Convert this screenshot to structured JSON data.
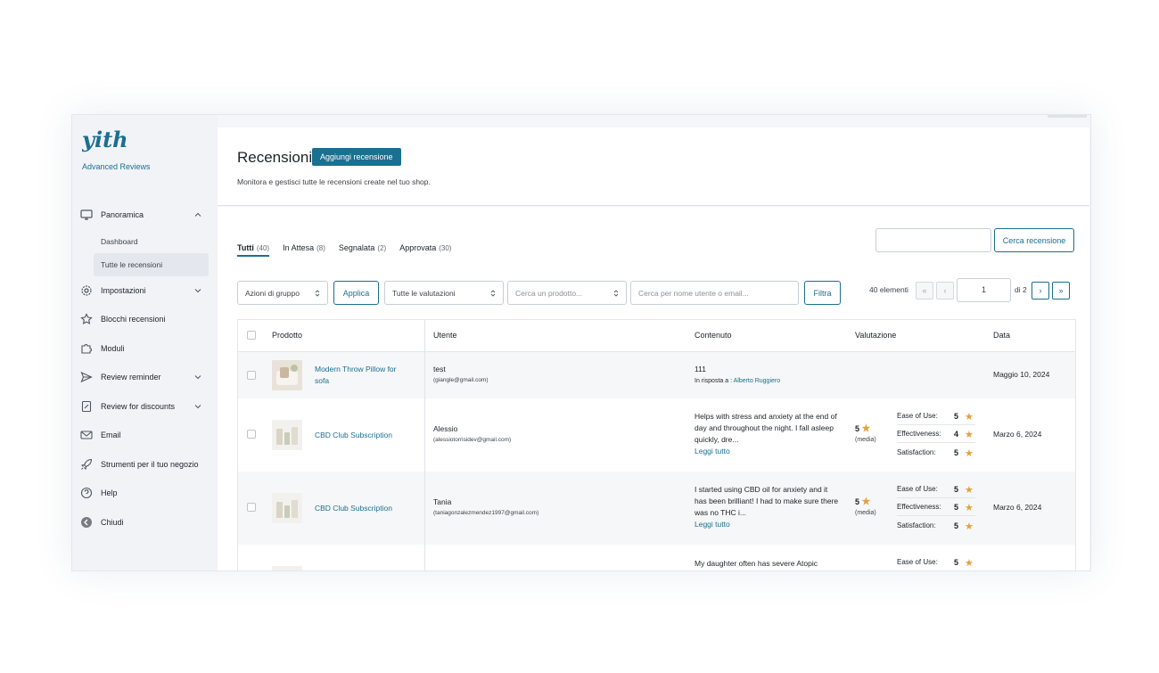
{
  "brand": {
    "logo_text": "yith",
    "product_name": "Advanced Reviews"
  },
  "sidebar": {
    "items": [
      {
        "label": "Panoramica",
        "icon": "monitor-icon",
        "expanded": true,
        "subitems": [
          {
            "label": "Dashboard"
          },
          {
            "label": "Tutte le recensioni",
            "active": true
          }
        ]
      },
      {
        "label": "Impostazioni",
        "icon": "gear-icon",
        "chevron": true
      },
      {
        "label": "Blocchi recensioni",
        "icon": "star-outline-icon"
      },
      {
        "label": "Moduli",
        "icon": "puzzle-icon"
      },
      {
        "label": "Review reminder",
        "icon": "send-icon",
        "chevron": true
      },
      {
        "label": "Review for discounts",
        "icon": "coupon-icon",
        "chevron": true
      },
      {
        "label": "Email",
        "icon": "mail-icon"
      },
      {
        "label": "Strumenti per il tuo negozio",
        "icon": "rocket-icon"
      },
      {
        "label": "Help",
        "icon": "help-icon"
      },
      {
        "label": "Chiudi",
        "icon": "collapse-icon"
      }
    ]
  },
  "header": {
    "title": "Recensioni",
    "add_button": "Aggiungi recensione",
    "subtitle": "Monitora e gestisci tutte le recensioni create nel tuo shop."
  },
  "search": {
    "value": "",
    "button": "Cerca recensione"
  },
  "tabs": [
    {
      "label": "Tutti",
      "count": "(40)",
      "active": true
    },
    {
      "label": "In Attesa",
      "count": "(8)"
    },
    {
      "label": "Segnalata",
      "count": "(2)"
    },
    {
      "label": "Approvata",
      "count": "(30)"
    }
  ],
  "filters": {
    "bulk_actions": "Azioni di gruppo",
    "apply": "Applica",
    "ratings": "Tutte le valutazioni",
    "product_placeholder": "Cerca un prodotto...",
    "user_placeholder": "Cerca per nome utente o email...",
    "filter_button": "Filtra"
  },
  "pagination": {
    "count": "40 elementi",
    "first": "«",
    "prev": "‹",
    "current": "1",
    "of": "di 2",
    "next": "›",
    "last": "»"
  },
  "table": {
    "columns": {
      "product": "Prodotto",
      "user": "Utente",
      "content": "Contenuto",
      "rating": "Valutazione",
      "date": "Data"
    },
    "rows": [
      {
        "product": "Modern Throw Pillow for sofa",
        "user": "test",
        "email": "(giangle@gmail.com)",
        "content": "111",
        "reply_prefix": "In risposta a :",
        "reply_to": "Alberto Ruggiero",
        "date": "Maggio 10, 2024"
      },
      {
        "product": "CBD Club Subscription",
        "user": "Alessio",
        "email": "(alessiotorrisidev@gmail.com)",
        "content": "Helps with stress and anxiety at the end of day and throughout the night. I fall asleep quickly, dre...",
        "read_more": "Leggi tutto",
        "avg": "5",
        "avg_label": "(media)",
        "criteria": [
          {
            "label": "Ease of Use:",
            "value": "5"
          },
          {
            "label": "Effectiveness:",
            "value": "4"
          },
          {
            "label": "Satisfaction:",
            "value": "5"
          }
        ],
        "date": "Marzo 6, 2024"
      },
      {
        "product": "CBD Club Subscription",
        "user": "Tania",
        "email": "(taniagonzalezmendez1997@gmail.com)",
        "content": "I started using CBD oil for anxiety and it has been brilliant! I had to make sure there was no THC i...",
        "read_more": "Leggi tutto",
        "avg": "5",
        "avg_label": "(media)",
        "criteria": [
          {
            "label": "Ease of Use:",
            "value": "5"
          },
          {
            "label": "Effectiveness:",
            "value": "5"
          },
          {
            "label": "Satisfaction:",
            "value": "5"
          }
        ],
        "date": "Marzo 6, 2024"
      },
      {
        "content": "My daughter often has severe Atopic",
        "criteria": [
          {
            "label": "Ease of Use:",
            "value": "5"
          }
        ]
      }
    ]
  },
  "colors": {
    "accent": "#1b6f8f",
    "star": "#e5a03a",
    "sidebar_bg": "#f1f3f7"
  }
}
